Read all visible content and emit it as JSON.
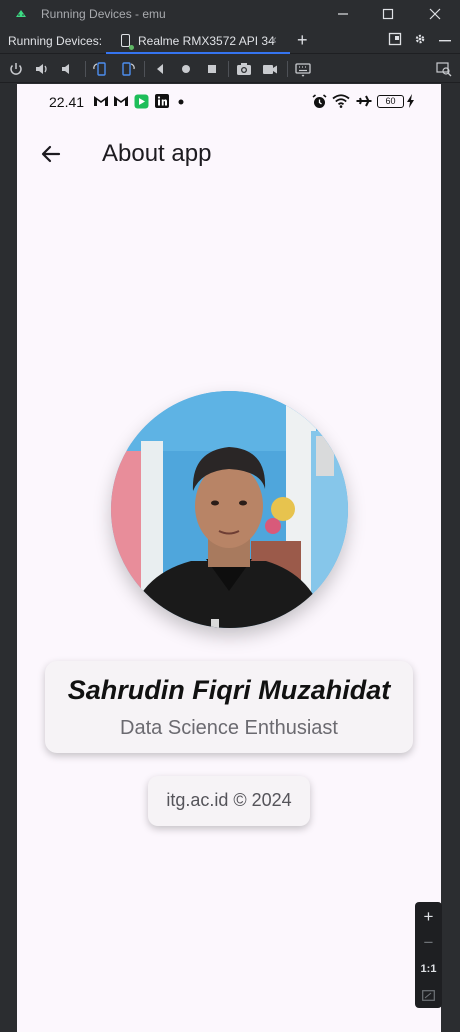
{
  "window": {
    "title": "Running Devices - emu",
    "minimize": "—",
    "maximize": "☐",
    "close": "✕"
  },
  "tabbar": {
    "label": "Running Devices:",
    "tab_label": "Realme RMX3572 API 34",
    "tab_close": "×",
    "add": "+"
  },
  "phone": {
    "status": {
      "time": "22.41",
      "battery": "60"
    },
    "appbar": {
      "title": "About app"
    },
    "profile": {
      "name": "Sahrudin Fiqri Muzahidat",
      "role": "Data Science Enthusiast"
    },
    "footer": {
      "text": "itg.ac.id © 2024"
    }
  },
  "zoom": {
    "zoom_in": "+",
    "zoom_out": "−",
    "actual_size": "1:1"
  },
  "colors": {
    "ide_bg": "#2b2d30",
    "accent": "#3574f0",
    "screen_bg": "#fcf7fd"
  }
}
